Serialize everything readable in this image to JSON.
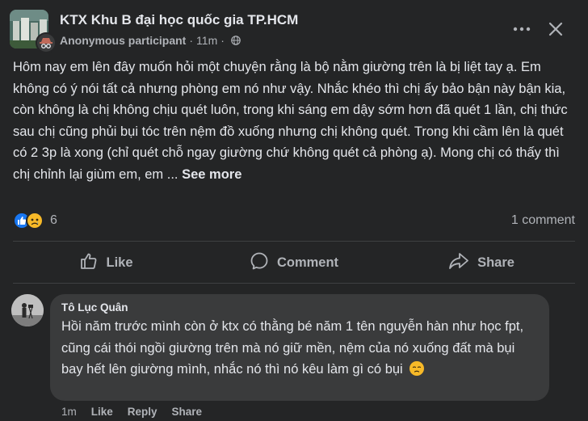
{
  "post": {
    "group_name": "KTX Khu B đại học quốc gia TP.HCM",
    "author": "Anonymous participant",
    "separator": "·",
    "time": "11m",
    "body": "Hôm nay em lên đây muốn hỏi một chuyện rằng là bộ nằm giường trên là bị liệt tay ạ. Em không có ý nói tất cả nhưng phòng em nó như vậy. Nhắc khéo thì chị ấy bảo bận này bận kia, còn không là chị không chịu quét luôn, trong khi sáng em dậy sớm hơn đã quét 1 lần, chị thức sau chị cũng phủi bụi tóc trên nệm đồ xuống nhưng chị không quét. Trong khi cầm lên là quét có 2 3p là xong (chỉ quét chỗ ngay giường chứ không quét cả phòng ạ). Mong chị có thấy thì chị chỉnh lại giùm em, em ...",
    "see_more": "See more",
    "reaction_count": "6",
    "comment_count": "1 comment"
  },
  "actions": {
    "like": "Like",
    "comment": "Comment",
    "share": "Share"
  },
  "comment": {
    "author": "Tô Lục Quân",
    "text": "Hồi năm trước mình còn ở ktx có thằng bé năm 1 tên nguyễn hàn như học fpt, cũng cái thói ngồi giường trên mà nó giữ mền, nệm của nó xuống đất mà bụi bay hết lên giường mình, nhắc nó thì nó kêu làm gì có bụi",
    "time": "1m",
    "like": "Like",
    "reply": "Reply",
    "share": "Share"
  },
  "colors": {
    "background": "#242526",
    "bubble": "#3a3b3c",
    "text_primary": "#e4e6eb",
    "text_secondary": "#b0b3b8",
    "like_blue": "#1877f2",
    "sad_yellow": "#f7b928"
  },
  "icons": [
    "group-avatar",
    "anonymous-icon",
    "globe-icon",
    "more-icon",
    "close-icon",
    "like-reaction-icon",
    "sad-reaction-icon",
    "thumbs-up-icon",
    "comment-icon",
    "share-icon",
    "sad-emoji-icon"
  ]
}
